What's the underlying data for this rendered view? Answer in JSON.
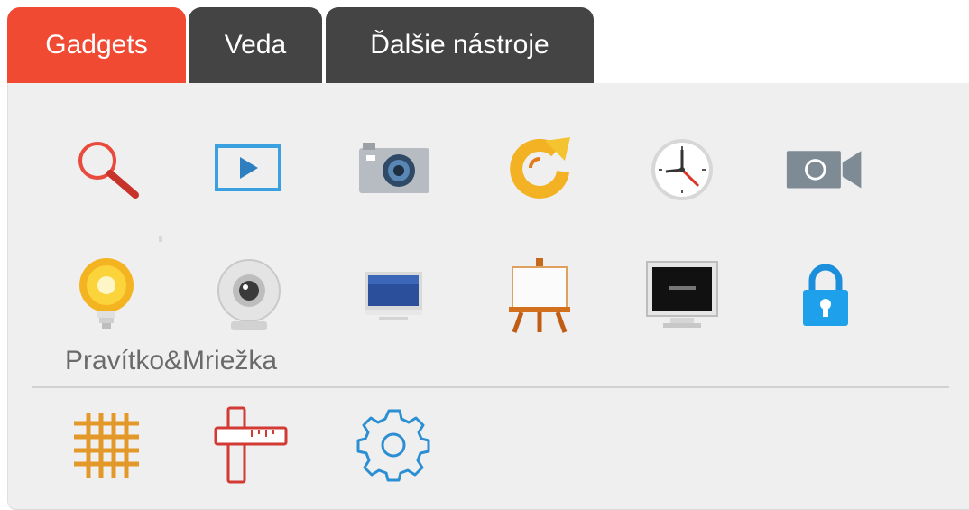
{
  "tabs": [
    {
      "label": "Gadgets",
      "active": true
    },
    {
      "label": "Veda",
      "active": false
    },
    {
      "label": "Ďalšie nástroje",
      "active": false
    }
  ],
  "colors": {
    "active_tab": "#f14a32",
    "inactive_tab": "#444444",
    "panel_bg": "#efefef",
    "label_text": "#6a6a6a"
  },
  "tools_row1": [
    "magnifier-icon",
    "video-player-icon",
    "camera-icon",
    "refresh-icon",
    "clock-icon",
    "video-camera-icon"
  ],
  "tools_row2": [
    "lightbulb-icon",
    "webcam-icon",
    "monitor-icon",
    "easel-icon",
    "display-screen-icon",
    "lock-icon"
  ],
  "section": {
    "label": "Pravítko&Mriežka",
    "tools": [
      "grid-icon",
      "ruler-icon",
      "settings-gear-icon"
    ]
  }
}
